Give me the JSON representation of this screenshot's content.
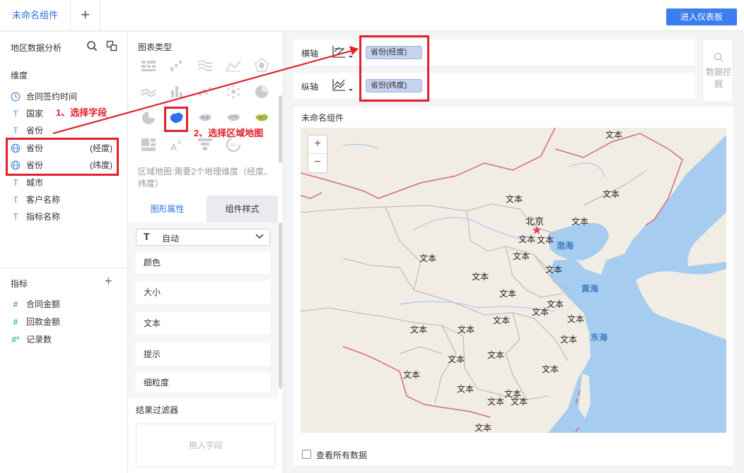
{
  "tabs": {
    "active": "未命名组件",
    "add": "+"
  },
  "header": {
    "enter_dashboard": "进入仪表板"
  },
  "left_panel": {
    "title": "地区数据分析",
    "dimension_label": "维度",
    "dimensions": [
      {
        "icon": "clock-icon",
        "name": "合同签约时间",
        "tag": ""
      },
      {
        "icon": "text-type-icon",
        "name": "国家",
        "tag": ""
      },
      {
        "icon": "text-type-icon",
        "name": "省份",
        "tag": ""
      },
      {
        "icon": "globe-icon",
        "name": "省份",
        "tag": "(经度)"
      },
      {
        "icon": "globe-icon",
        "name": "省份",
        "tag": "(纬度)"
      },
      {
        "icon": "text-type-icon",
        "name": "城市",
        "tag": ""
      },
      {
        "icon": "text-type-icon",
        "name": "客户名称",
        "tag": ""
      },
      {
        "icon": "text-type-icon",
        "name": "指标名称",
        "tag": ""
      }
    ],
    "metric_label": "指标",
    "metrics": [
      {
        "icon": "#",
        "name": "合同金额"
      },
      {
        "icon": "#",
        "name": "回款金额"
      },
      {
        "icon": "#°",
        "name": "记录数"
      }
    ]
  },
  "annotations": {
    "step1": "1、选择字段",
    "step2": "2、选择区域地图"
  },
  "chart_panel": {
    "title": "图表类型",
    "description": "区域地图:需要2个地理维度（经度、纬度）",
    "tab_props": "图形属性",
    "tab_style": "组件样式",
    "select_value": "自动",
    "props": [
      "颜色",
      "大小",
      "文本",
      "提示",
      "细粒度"
    ],
    "filter_title": "结果过滤器",
    "filter_placeholder": "拖入字段"
  },
  "axes": {
    "x_label": "横轴",
    "x_field": "省份(经度)",
    "y_label": "纵轴",
    "y_field": "省份(纬度)"
  },
  "data_mining": "数据挖掘",
  "chart": {
    "title": "未命名组件",
    "zoom_in": "+",
    "zoom_out": "−",
    "city_label": "北京",
    "point_label": "文本",
    "seas": [
      "渤海",
      "黄海",
      "东海"
    ],
    "show_all": "查看所有数据"
  },
  "colors": {
    "accent": "#2f6fe4",
    "annotation": "#e0202a",
    "sea": "#a6cdf0",
    "land": "#f1ece4"
  }
}
